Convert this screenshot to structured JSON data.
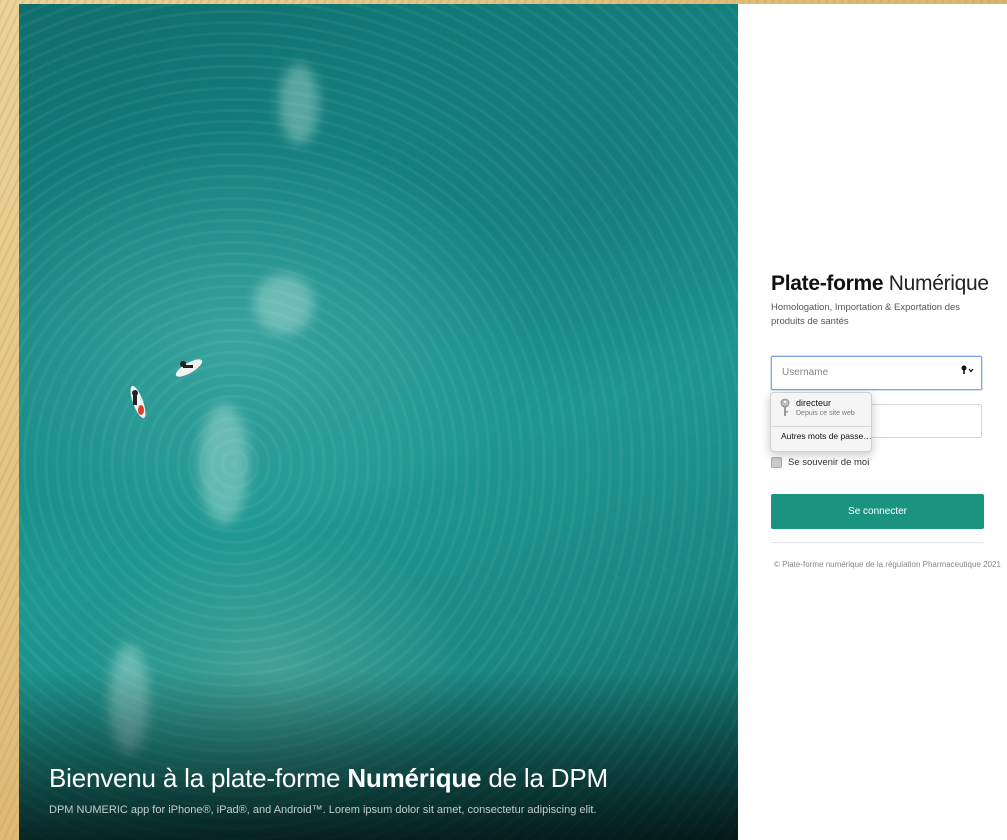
{
  "hero": {
    "title_pre": "Bienvenu à la plate-forme ",
    "title_bold": "Numérique",
    "title_post": " de la DPM",
    "subtitle": "DPM NUMERIC app for iPhone®, iPad®, and Android™. Lorem ipsum dolor sit amet, consectetur adipiscing elit."
  },
  "login": {
    "brand_bold": "Plate-forme",
    "brand_light": " Numérique",
    "tagline": "Homologation, Importation & Exportation des produits de santés",
    "username_placeholder": "Username",
    "password_placeholder": "",
    "remember_label": "Se souvenir de moi",
    "submit_label": "Se connecter",
    "copyright": "© Plate-forme numérique de la régulation Pharmaceutique 2021"
  },
  "autofill": {
    "user": "directeur",
    "source": "Depuis ce site web",
    "more": "Autres mots de passe…"
  },
  "icons": {
    "password_key": "key-icon",
    "dropdown_key": "key-icon"
  },
  "colors": {
    "primary": "#1a9381",
    "focus": "#79a7e8"
  }
}
